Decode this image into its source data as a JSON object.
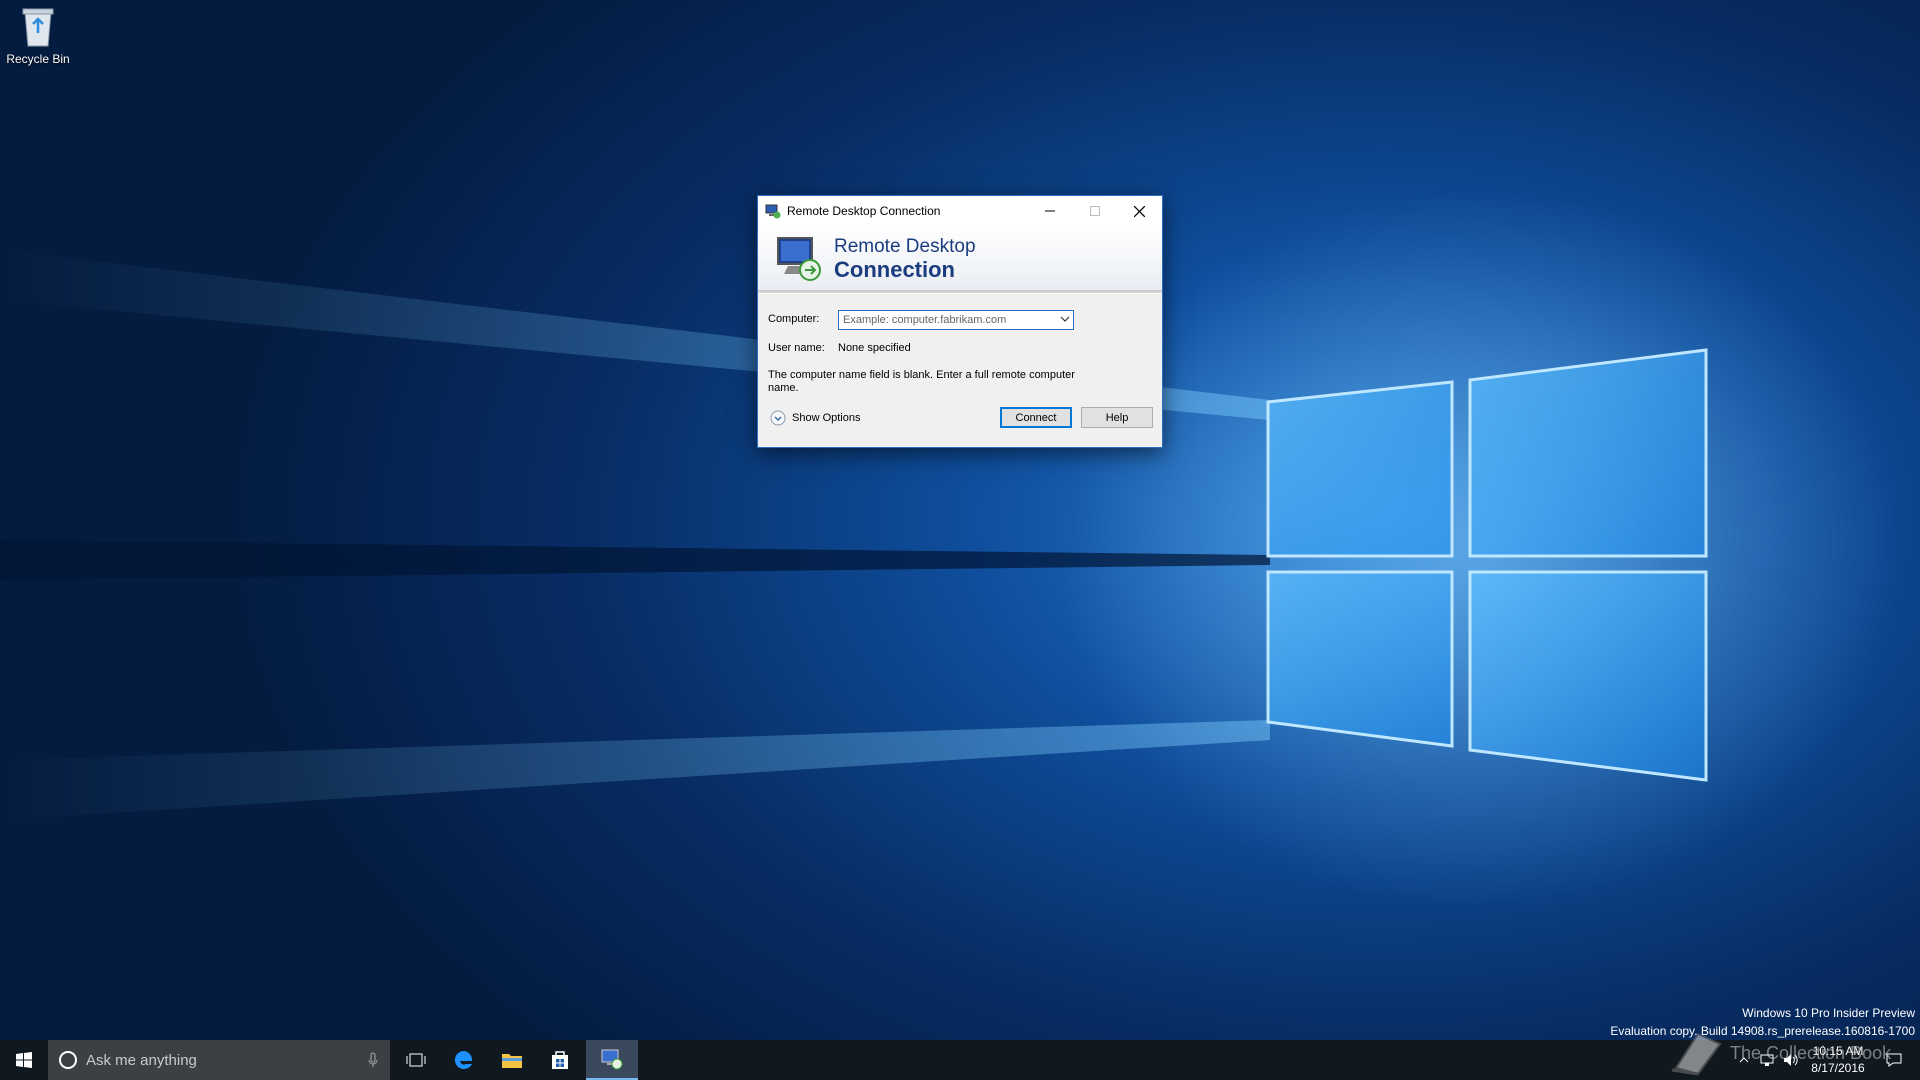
{
  "desktop": {
    "icons": [
      {
        "label": "Recycle Bin",
        "icon": "recycle-bin-icon"
      }
    ]
  },
  "dialog": {
    "title": "Remote Desktop Connection",
    "banner_line1": "Remote Desktop",
    "banner_line2": "Connection",
    "computer_label": "Computer:",
    "computer_placeholder": "Example: computer.fabrikam.com",
    "username_label": "User name:",
    "username_value": "None specified",
    "message": "The computer name field is blank.  Enter a full remote computer name.",
    "show_options_label": "Show Options",
    "connect_label": "Connect",
    "help_label": "Help"
  },
  "watermark": {
    "line1": "Windows 10 Pro Insider Preview",
    "line2": "Evaluation copy. Build 14908.rs_prerelease.160816-1700"
  },
  "taskbar": {
    "search_placeholder": "Ask me anything",
    "pinned": [
      "windows-start-icon",
      "task-view-icon",
      "edge-icon",
      "file-explorer-icon",
      "store-icon",
      "remote-desktop-icon"
    ],
    "clock_time": "10:15 AM",
    "clock_date": "8/17/2016",
    "overlay_text": "The Collection Book"
  },
  "colors": {
    "accent": "#0078d7",
    "taskbar": "#101820",
    "banner_text": "#1b3c7e"
  }
}
